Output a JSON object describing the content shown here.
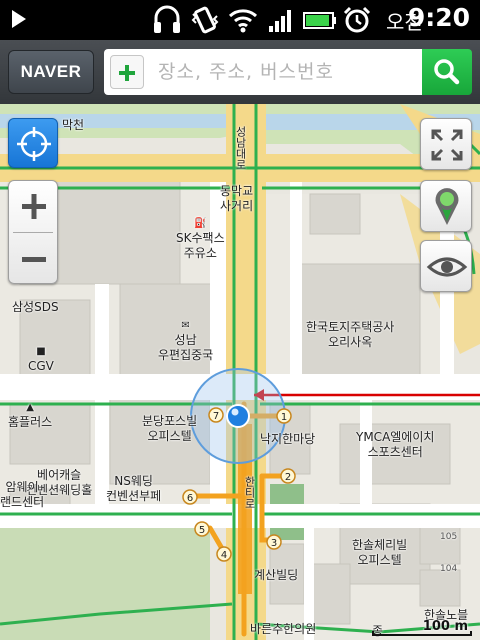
{
  "status_bar": {
    "ampm": "오전",
    "time": "9:20"
  },
  "app_bar": {
    "brand_label": "NAVER",
    "search_placeholder": "장소, 주소, 버스번호"
  },
  "map_labels": {
    "river": "막천",
    "street_top": "성남대로",
    "intersection_line1": "동막교",
    "intersection_line2": "사거리",
    "gas_station_line1": "SK수팩스",
    "gas_station_line2": "주유소",
    "samsung_sds": "삼성SDS",
    "post_office_line1": "성남",
    "post_office_line2": "우편집중국",
    "land_corp_line1": "한국토지주택공사",
    "land_corp_line2": "오리사옥",
    "cgv": "CGV",
    "homeplus": "홈플러스",
    "officetel_line1": "분당포스빌",
    "officetel_line2": "오피스텔",
    "restaurant": "낙지한마당",
    "ymca_line1": "YMCA엘에이치",
    "ymca_line2": "스포츠센터",
    "wedding_line1": "베어캐슬",
    "wedding_line2": "컨벤션웨딩홀",
    "amway_line1": "암웨이",
    "amway_line2": "랜드센터",
    "ns_wedding_line1": "NS웨딩",
    "ns_wedding_line2": "컨벤션부페",
    "building": "계산빌딩",
    "hansol_line1": "한솔체리빌",
    "hansol_line2": "오피스텔",
    "clinic": "바른추한의원",
    "hansol_noble": "한솔노블",
    "bottom_left": "종",
    "apt_105": "105",
    "apt_104": "104",
    "street_vertical": "한티로"
  },
  "exits": [
    "1",
    "2",
    "3",
    "4",
    "5",
    "6",
    "7"
  ],
  "scale": {
    "label": "100 m"
  },
  "colors": {
    "status_bar": "#000000",
    "app_bar": "#3c4045",
    "search_button": "#22b644",
    "road_yellow": "#f4d98a",
    "subway_green": "#2eb04f",
    "subway_orange": "#f3a21f",
    "route_red": "#d80000",
    "location_blue": "#1f7fe0"
  }
}
